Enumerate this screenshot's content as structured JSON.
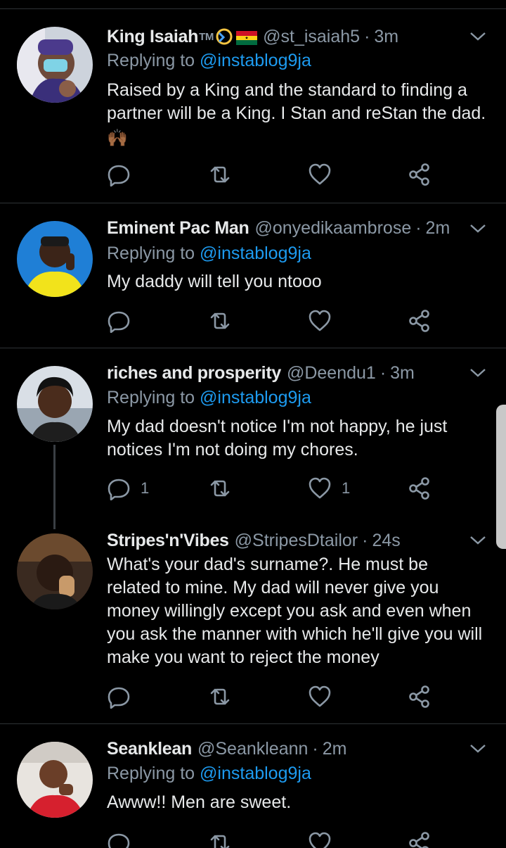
{
  "tweets": [
    {
      "name": "King Isaiah",
      "name_suffix": "TM",
      "handle": "@st_isaiah5",
      "time": "3m",
      "replying_prefix": "Replying to",
      "replying_to": "@instablog9ja",
      "text": "Raised by a King and the standard to finding a partner will be a King. I Stan and reStan the dad.",
      "emoji": "🙌🏾",
      "reply_count": "",
      "like_count": ""
    },
    {
      "name": "Eminent Pac Man",
      "handle": "@onyedikaambrose",
      "time": "2m",
      "replying_prefix": "Replying to",
      "replying_to": "@instablog9ja",
      "text": "My daddy will tell you ntooo",
      "reply_count": "",
      "like_count": ""
    },
    {
      "name": "riches and prosperity",
      "handle": "@Deendu1",
      "time": "3m",
      "replying_prefix": "Replying to",
      "replying_to": "@instablog9ja",
      "text": "My dad doesn't notice I'm not happy,  he just notices I'm not doing my chores.",
      "reply_count": "1",
      "like_count": "1"
    },
    {
      "name": "Stripes'n'Vibes",
      "handle": "@StripesDtailor",
      "time": "24s",
      "text": "What's your dad's surname?. He must be related to mine. My dad will never give you money willingly except you ask and even when you ask the manner with which he'll give you will make you want to reject the money",
      "reply_count": "",
      "like_count": ""
    },
    {
      "name": "Seanklean",
      "handle": "@Seankleann",
      "time": "2m",
      "replying_prefix": "Replying to",
      "replying_to": "@instablog9ja",
      "text": "Awww!! Men are sweet."
    }
  ],
  "icons": {
    "reply": "reply-icon",
    "retweet": "retweet-icon",
    "like": "heart-icon",
    "share": "share-icon",
    "more": "chevron-down-icon"
  },
  "colors": {
    "background": "#000000",
    "link": "#1d9bf0",
    "muted": "#8b98a5",
    "text": "#e7e9ea"
  }
}
